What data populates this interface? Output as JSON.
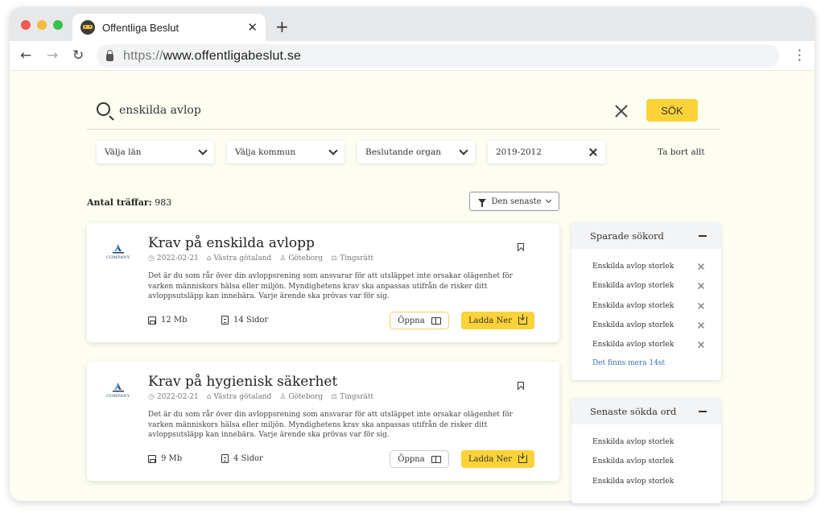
{
  "browser": {
    "tab_title": "Offentliga Beslut",
    "url_scheme": "https://",
    "url_host": "www.offentligabeslut.se"
  },
  "search": {
    "query": "enskilda avlop",
    "button_label": "SÖK"
  },
  "filters": {
    "lan": "Välja län",
    "kommun": "Välja kommun",
    "organ": "Beslutande organ",
    "years": "2019-2012",
    "remove_all": "Ta bort allt"
  },
  "results": {
    "count_label": "Antal träffar:",
    "count": "983",
    "sort_label": "Den senaste"
  },
  "cards": [
    {
      "title": "Krav på enskilda avlopp",
      "date": "2022-02-21",
      "region": "Västra götaland",
      "city": "Göteborg",
      "court": "Tingsrätt",
      "description": "Det är du som rår över din avloppsrening som ansvarar för att utsläppet inte orsakar olägenhet för varken människors hälsa eller miljön. Myndighetens krav ska anpassas utifrån de risker ditt avloppsutsläpp kan innebära. Varje ärende ska prövas var för sig.",
      "size": "12 Mb",
      "pages": "14 Sidor",
      "open_label": "Öppna",
      "download_label": "Ladda Ner",
      "logo_text": "COMPANY"
    },
    {
      "title": "Krav på hygienisk säkerhet",
      "date": "2022-02-21",
      "region": "Västra götaland",
      "city": "Göteborg",
      "court": "Tingsrätt",
      "description": "Det är du som rår över din avloppsrening som ansvarar för att utsläppet inte orsakar olägenhet för varken människors hälsa eller miljön. Myndighetens krav ska anpassas utifrån de risker ditt avloppsutsläpp kan innebära. Varje ärende ska prövas var för sig.",
      "size": "9 Mb",
      "pages": "4 Sidor",
      "open_label": "Öppna",
      "download_label": "Ladda Ner",
      "logo_text": "COMPANY"
    }
  ],
  "saved": {
    "title": "Sparade sökord",
    "items": [
      "Enskilda avlop storlek",
      "Enskilda avlop storlek",
      "Enskilda avlop storlek",
      "Enskilda avlop storlek",
      "Enskilda avlop storlek"
    ],
    "more": "Det finns mera 14st"
  },
  "recent": {
    "title": "Senaste sökda ord",
    "items": [
      "Enskilda avlop storlek",
      "Enskilda avlop storlek",
      "Enskilda avlop storlek"
    ]
  },
  "colors": {
    "accent": "#fbd338",
    "page_bg": "#fdfdf2",
    "link": "#3a6fb0"
  }
}
